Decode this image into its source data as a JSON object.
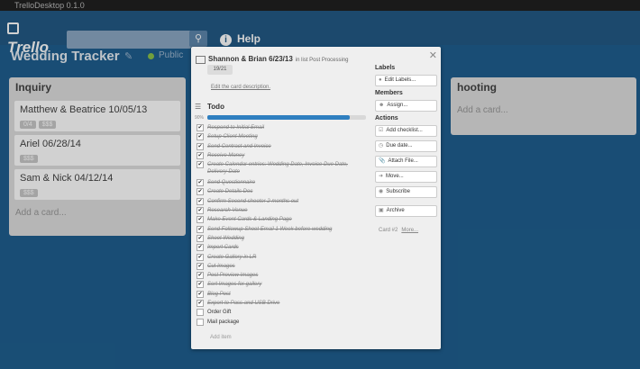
{
  "window": {
    "title": "TrelloDesktop 0.1.0"
  },
  "header": {
    "logo": "Trello",
    "help_label": "Help"
  },
  "board": {
    "title": "Wedding Tracker",
    "visibility": "Public"
  },
  "lists": {
    "inquiry": {
      "title": "Inquiry",
      "cards": [
        {
          "title": "Matthew & Beatrice 10/05/13",
          "badges": [
            "0/4",
            "$$$"
          ]
        },
        {
          "title": "Ariel 06/28/14",
          "badges": [
            "$$$"
          ]
        },
        {
          "title": "Sam & Nick 04/12/14",
          "badges": [
            "$$$"
          ]
        }
      ],
      "add_card": "Add a card..."
    },
    "shooting": {
      "title": "hooting",
      "add_card": "Add a card..."
    }
  },
  "modal": {
    "title": "Shannon & Brian 6/23/13",
    "in_list": "in list Post Processing",
    "checklist_badge": "19/21",
    "edit_description": "Edit the card description.",
    "checklist": {
      "title": "Todo",
      "percent_label": "90%",
      "percent": 0.9,
      "items": [
        {
          "text": "Respond to Initial Email",
          "done": true
        },
        {
          "text": "Setup Client Meeting",
          "done": true
        },
        {
          "text": "Send Contract and Invoice",
          "done": true
        },
        {
          "text": "Receive Money",
          "done": true
        },
        {
          "text": "Create Calendar entries: Wedding Date, Invoice Due Date, Delivery Date",
          "done": true
        },
        {
          "text": "Send Questionnaire",
          "done": true
        },
        {
          "text": "Create Details Doc",
          "done": true
        },
        {
          "text": "Confirm Second shooter 2 months out",
          "done": true
        },
        {
          "text": "Research Venue",
          "done": true
        },
        {
          "text": "Make Event Cards & Landing Page",
          "done": true
        },
        {
          "text": "Send Followup Shoot Email 1 Week before wedding",
          "done": true
        },
        {
          "text": "Shoot Wedding",
          "done": true
        },
        {
          "text": "Import Cards",
          "done": true
        },
        {
          "text": "Create Gallery in LR",
          "done": true
        },
        {
          "text": "Cut Images",
          "done": true
        },
        {
          "text": "Post Preview Images",
          "done": true
        },
        {
          "text": "Sort Images for gallery",
          "done": true
        },
        {
          "text": "Blog Post",
          "done": true
        },
        {
          "text": "Export to Pass and USB Drive",
          "done": true
        },
        {
          "text": "Order Gift",
          "done": false
        },
        {
          "text": "Mail package",
          "done": false
        }
      ],
      "add_item": "Add item"
    },
    "sidebar": {
      "labels_heading": "Labels",
      "edit_labels": "Edit Labels...",
      "members_heading": "Members",
      "assign": "Assign...",
      "actions_heading": "Actions",
      "add_checklist": "Add checklist...",
      "due_date": "Due date...",
      "attach_file": "Attach File...",
      "move": "Move...",
      "subscribe": "Subscribe",
      "archive": "Archive"
    },
    "card_number": "Card #2",
    "more": "More..."
  }
}
